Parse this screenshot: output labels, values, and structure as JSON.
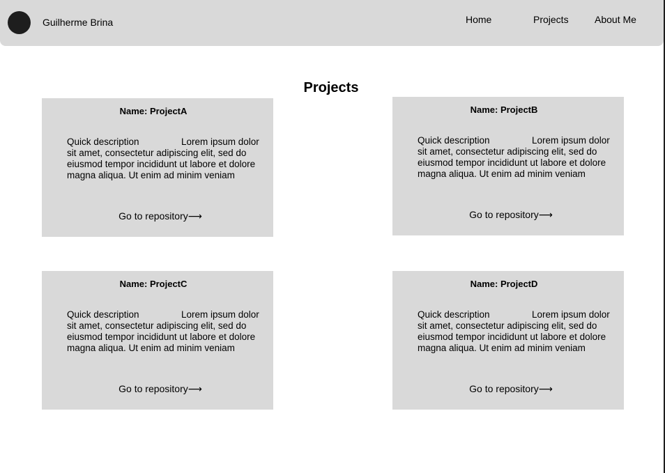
{
  "navbar": {
    "brand_name": "Guilherme Brina",
    "links": {
      "home": "Home",
      "projects": "Projects",
      "about": "About Me"
    }
  },
  "page": {
    "title": "Projects"
  },
  "projects": [
    {
      "name": "Name: ProjectA",
      "desc_label": "Quick description",
      "desc_text": "Lorem ipsum dolor sit amet, consectetur adipiscing elit, sed do eiusmod tempor incididunt ut labore et dolore magna aliqua. Ut enim ad minim veniam",
      "link_label": "Go to repository",
      "link_arrow": "⟶"
    },
    {
      "name": "Name: ProjectB",
      "desc_label": "Quick description",
      "desc_text": "Lorem ipsum dolor sit amet, consectetur adipiscing elit, sed do eiusmod tempor incididunt ut labore et dolore magna aliqua. Ut enim ad minim veniam",
      "link_label": "Go to repository",
      "link_arrow": "⟶"
    },
    {
      "name": "Name: ProjectC",
      "desc_label": "Quick description",
      "desc_text": "Lorem ipsum dolor sit amet, consectetur adipiscing elit, sed do eiusmod tempor incididunt ut labore et dolore magna aliqua. Ut enim ad minim veniam",
      "link_label": "Go to repository",
      "link_arrow": "⟶"
    },
    {
      "name": "Name: ProjectD",
      "desc_label": "Quick description",
      "desc_text": "Lorem ipsum dolor sit amet, consectetur adipiscing elit, sed do eiusmod tempor incididunt ut labore et dolore magna aliqua. Ut enim ad minim veniam",
      "link_label": "Go to repository",
      "link_arrow": "⟶"
    }
  ],
  "colors": {
    "navbar_bg": "#d9d9d9",
    "card_bg": "#d9d9d9",
    "avatar": "#1e1e1e",
    "text": "#000000"
  }
}
